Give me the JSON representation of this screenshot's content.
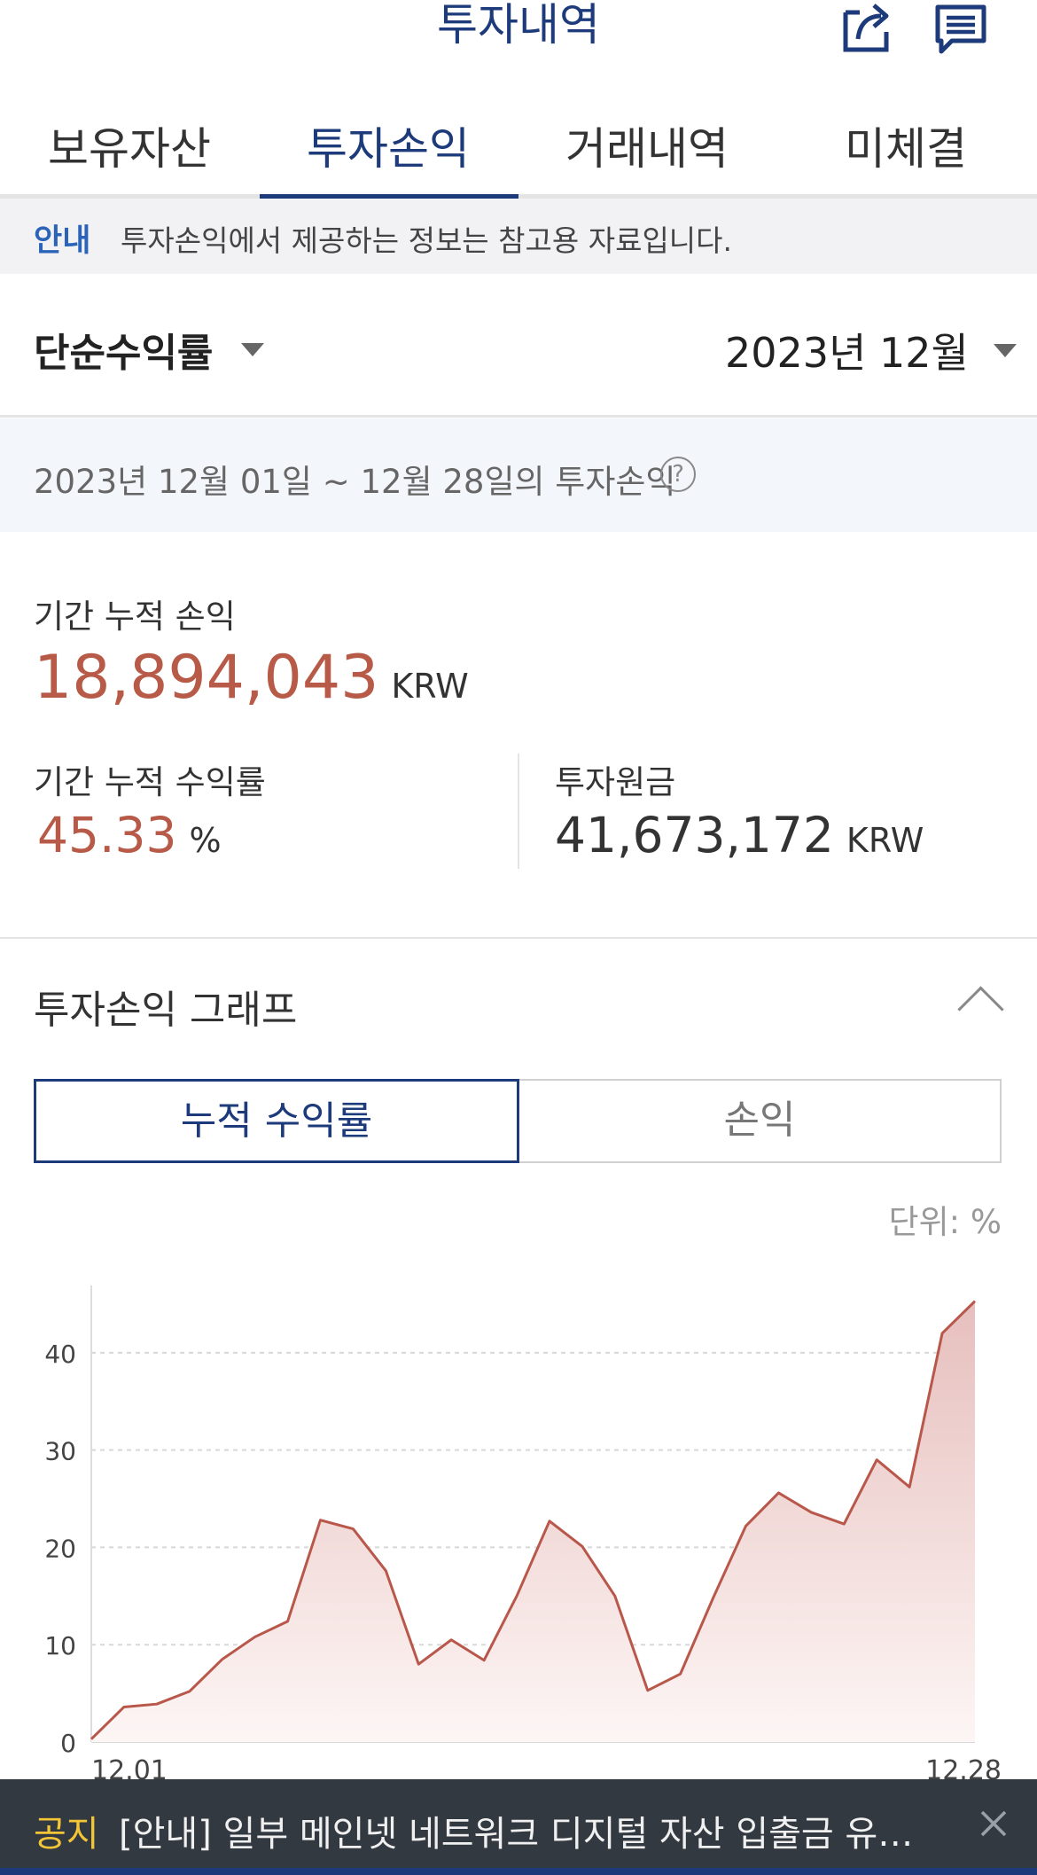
{
  "header": {
    "title": "투자내역",
    "share_icon": "share-icon",
    "notes_icon": "notes-icon"
  },
  "tabs": [
    {
      "label": "보유자산",
      "active": false
    },
    {
      "label": "투자손익",
      "active": true
    },
    {
      "label": "거래내역",
      "active": false
    },
    {
      "label": "미체결",
      "active": false
    }
  ],
  "notice": {
    "tag": "안내",
    "text": "투자손익에서 제공하는 정보는 참고용 자료입니다."
  },
  "filter": {
    "type": "단순수익률",
    "date": "2023년 12월"
  },
  "period": {
    "text": "2023년 12월 01일 ~ 12월 28일의 투자손익",
    "help": "?"
  },
  "summary": {
    "cumulative_pnl_label": "기간 누적 손익",
    "cumulative_pnl_value": "18,894,043",
    "cumulative_pnl_unit": "KRW",
    "cumulative_rate_label": "기간 누적 수익률",
    "cumulative_rate_value": "45.33",
    "cumulative_rate_unit": "%",
    "principal_label": "투자원금",
    "principal_value": "41,673,172",
    "principal_unit": "KRW"
  },
  "graph": {
    "title": "투자손익 그래프",
    "segments": [
      "누적 수익률",
      "손익"
    ],
    "active_segment": 0,
    "unit_note": "단위: %"
  },
  "chart_data": {
    "type": "area",
    "x_labels_shown": [
      "12.01",
      "12.28"
    ],
    "x": [
      "12.01",
      "12.02",
      "12.03",
      "12.04",
      "12.05",
      "12.06",
      "12.07",
      "12.08",
      "12.09",
      "12.10",
      "12.11",
      "12.12",
      "12.13",
      "12.14",
      "12.15",
      "12.16",
      "12.17",
      "12.18",
      "12.19",
      "12.20",
      "12.21",
      "12.22",
      "12.23",
      "12.24",
      "12.25",
      "12.26",
      "12.27",
      "12.28"
    ],
    "values": [
      0.3,
      3.6,
      3.9,
      5.2,
      8.5,
      10.8,
      12.4,
      22.8,
      21.9,
      17.6,
      8.0,
      10.5,
      8.4,
      15.0,
      22.7,
      20.1,
      15.0,
      5.3,
      7.0,
      14.8,
      22.2,
      25.6,
      23.6,
      22.4,
      29.0,
      26.2,
      42.0,
      45.3
    ],
    "yticks": [
      0,
      10,
      20,
      30,
      40
    ],
    "ylim": [
      0,
      46
    ],
    "grid": true,
    "colors": {
      "line": "#b8574a",
      "fill_top": "#e6bfbd",
      "fill_bottom": "#fdf6f5"
    }
  },
  "banner": {
    "tag": "공지",
    "text": "[안내] 일부 메인넷 네트워크 디지털 자산 입출금 유의…",
    "close_icon": "close-icon"
  },
  "colors": {
    "brand": "#1d3a7a",
    "profit_red": "#b85a48",
    "notice_blue": "#2b63b8",
    "banner_bg": "#333941",
    "banner_tag": "#f3c638"
  }
}
